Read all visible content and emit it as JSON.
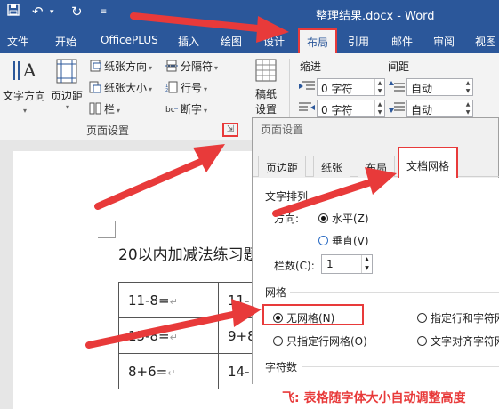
{
  "titlebar": {
    "doc_title": "整理结果.docx  -  Word"
  },
  "tabs": [
    "文件",
    "开始",
    "OfficePLUS",
    "插入",
    "绘图",
    "设计",
    "布局",
    "引用",
    "邮件",
    "审阅",
    "视图"
  ],
  "ribbon": {
    "text_direction": "文字方向",
    "margins": "页边距",
    "orientation": "纸张方向",
    "size": "纸张大小",
    "columns": "栏",
    "breaks": "分隔符",
    "line_numbers": "行号",
    "hyphenation": "断字",
    "manuscript_line1": "稿纸",
    "manuscript_line2": "设置",
    "group_page_setup": "页面设置",
    "indent_label": "缩进",
    "spacing_label": "间距",
    "indent_left": "0 字符",
    "indent_right": "0 字符",
    "spacing_before": "自动",
    "spacing_after": "自动"
  },
  "document": {
    "heading": "20以内加减法练习题",
    "table": [
      [
        "11-8=",
        "11-"
      ],
      [
        "15-8=",
        "9+8"
      ],
      [
        "8+6=",
        "14-"
      ]
    ]
  },
  "dialog": {
    "title": "页面设置",
    "tabs": [
      "页边距",
      "纸张",
      "布局",
      "文档网格"
    ],
    "text_arrangement": {
      "section": "文字排列",
      "direction_label": "方向:",
      "horizontal": "水平(Z)",
      "vertical": "垂直(V)",
      "columns_label": "栏数(C):",
      "columns_value": "1"
    },
    "grid": {
      "section": "网格",
      "no_grid": "无网格(N)",
      "line_and_char": "指定行和字符网格",
      "line_only": "只指定行网格(O)",
      "align_chars": "文字对齐字符网格"
    },
    "chars_section": "字符数"
  },
  "caption": "飞: 表格随字体大小自动调整高度",
  "colors": {
    "word_blue": "#2b579a",
    "annotation_red": "#e83a3a"
  }
}
